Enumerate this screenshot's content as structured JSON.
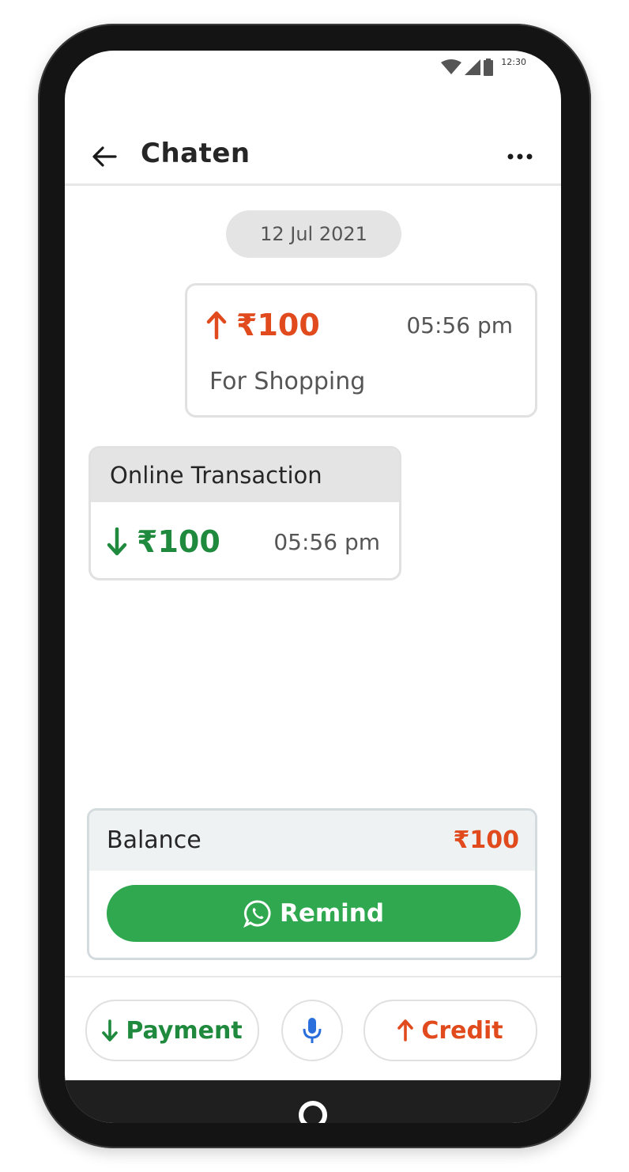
{
  "status_bar": {
    "time": "12:30"
  },
  "header": {
    "title": "Chaten"
  },
  "date_chip": "12 Jul 2021",
  "sent_txn": {
    "amount": "₹100",
    "time": "05:56 pm",
    "note": "For Shopping"
  },
  "received_txn": {
    "title": "Online Transaction",
    "amount": "₹100",
    "time": "05:56 pm"
  },
  "balance": {
    "label": "Balance",
    "value": "₹100",
    "remind_label": "Remind"
  },
  "actions": {
    "payment_label": "Payment",
    "credit_label": "Credit"
  },
  "colors": {
    "accent_red": "#e04a1c",
    "accent_green": "#1f8a3d",
    "remind_green": "#2fa84f",
    "mic_blue": "#2a6fdb"
  }
}
